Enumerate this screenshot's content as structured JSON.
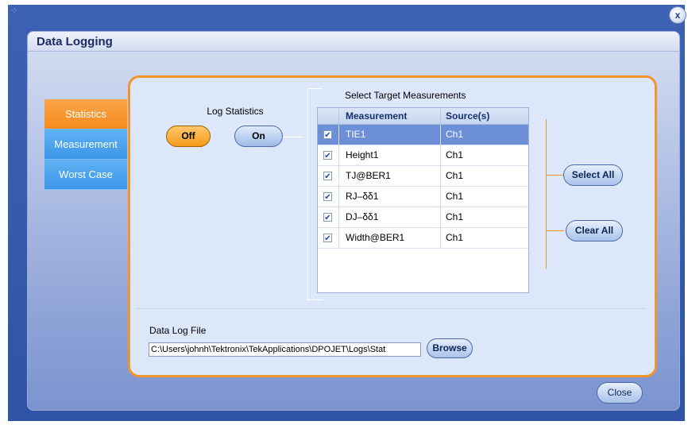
{
  "window": {
    "grip_glyph": "⁘",
    "close_glyph": "x"
  },
  "dialog": {
    "title": "Data Logging",
    "close_label": "Close"
  },
  "tabs": [
    {
      "label": "Statistics",
      "active": true
    },
    {
      "label": "Measurement",
      "active": false
    },
    {
      "label": "Worst Case",
      "active": false
    }
  ],
  "log_statistics": {
    "label": "Log Statistics",
    "off_label": "Off",
    "on_label": "On",
    "selected": "Off"
  },
  "target_measurements": {
    "label": "Select Target Measurements",
    "columns": [
      "Measurement",
      "Source(s)"
    ],
    "check_glyph": "✔",
    "rows": [
      {
        "measurement": "TIE1",
        "source": "Ch1",
        "checked": true,
        "selected": true
      },
      {
        "measurement": "Height1",
        "source": "Ch1",
        "checked": true,
        "selected": false
      },
      {
        "measurement": "TJ@BER1",
        "source": "Ch1",
        "checked": true,
        "selected": false
      },
      {
        "measurement": "RJ–δδ1",
        "source": "Ch1",
        "checked": true,
        "selected": false
      },
      {
        "measurement": "DJ–δδ1",
        "source": "Ch1",
        "checked": true,
        "selected": false
      },
      {
        "measurement": "Width@BER1",
        "source": "Ch1",
        "checked": true,
        "selected": false
      }
    ],
    "select_all_label": "Select All",
    "clear_all_label": "Clear All"
  },
  "data_log_file": {
    "label": "Data Log File",
    "value": "C:\\Users\\johnh\\Tektronix\\TekApplications\\DPOJET\\Logs\\Stat",
    "browse_label": "Browse"
  },
  "colors": {
    "accent_orange": "#f1952c",
    "tab_blue": "#3c96e8",
    "selection_blue": "#6c8fd8"
  }
}
